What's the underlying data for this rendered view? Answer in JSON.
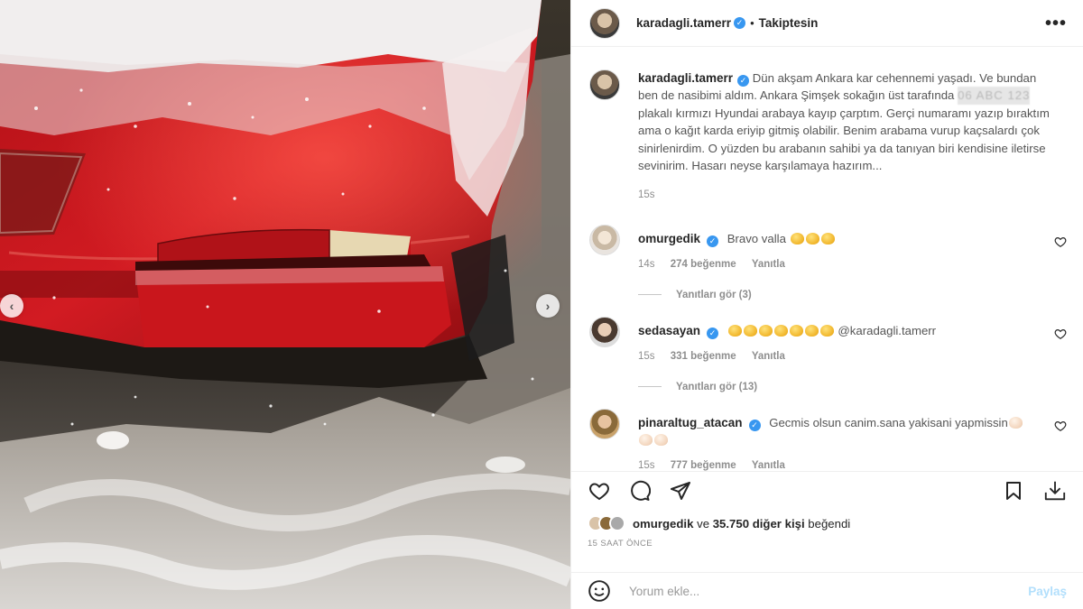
{
  "photo": {
    "prev_arrow": "‹",
    "next_arrow": "›"
  },
  "header": {
    "username": "karadagli.tamerr",
    "separator": "•",
    "follow_label": "Takiptesin",
    "more_label": "•••"
  },
  "caption": {
    "username": "karadagli.tamerr",
    "text_before_plate": "Dün akşam Ankara kar cehennemi yaşadı. Ve bundan ben de nasibimi aldım. Ankara Şimşek sokağın üst tarafında",
    "plate_blurred": "06 ABC 123",
    "text_after_plate": "plakalı kırmızı Hyundai arabaya kayıp çarptım. Gerçi numaramı yazıp bıraktım ama o kağıt karda eriyip gitmiş olabilir. Benim arabama vurup kaçsalardı çok sinirlenirdim. O yüzden bu arabanın sahibi ya da tanıyan biri kendisine iletirse sevinirim. Hasarı neyse karşılamaya hazırım...",
    "time": "15s"
  },
  "comments": [
    {
      "username": "omurgedik",
      "text": "Bravo valla",
      "emoji_count": 3,
      "time": "14s",
      "likes": "274 beğenme",
      "reply_label": "Yanıtla",
      "view_replies": "Yanıtları gör (3)"
    },
    {
      "username": "sedasayan",
      "text": "@karadagli.tamerr",
      "emoji_count": 7,
      "time": "15s",
      "likes": "331 beğenme",
      "reply_label": "Yanıtla",
      "view_replies": "Yanıtları gör (13)"
    },
    {
      "username": "pinaraltug_atacan",
      "text": "Gecmis olsun canim.sana yakisani yapmissin",
      "emoji_count": 3,
      "time": "15s",
      "likes": "777 beğenme",
      "reply_label": "Yanıtla"
    }
  ],
  "likes_summary": {
    "user": "omurgedik",
    "connector": "ve",
    "count_text": "35.750 diğer kişi",
    "suffix": "beğendi"
  },
  "post_time": "15 SAAT ÖNCE",
  "add_comment": {
    "placeholder": "Yorum ekle...",
    "post_label": "Paylaş"
  },
  "colors": {
    "verified": "#3897f0",
    "car_red": "#c8161c",
    "muted_text": "#8e8e8e",
    "post_button": "#b2dffc"
  }
}
